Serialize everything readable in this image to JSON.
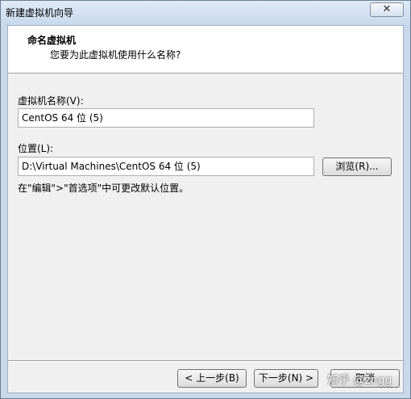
{
  "window": {
    "title": "新建虚拟机向导",
    "close_glyph": "✕"
  },
  "header": {
    "title": "命名虚拟机",
    "subtitle": "您要为此虚拟机使用什么名称?"
  },
  "form": {
    "vm_name_label": "虚拟机名称(V):",
    "vm_name_value": "CentOS 64 位 (5)",
    "location_label": "位置(L):",
    "location_value": "D:\\Virtual Machines\\CentOS 64 位 (5)",
    "browse_label": "浏览(R)...",
    "hint": "在\"编辑\">\"首选项\"中可更改默认位置。"
  },
  "footer": {
    "back_label": "< 上一步(B)",
    "next_label": "下一步(N) >",
    "cancel_label": "取消"
  },
  "watermark": "知乎 @zngg"
}
